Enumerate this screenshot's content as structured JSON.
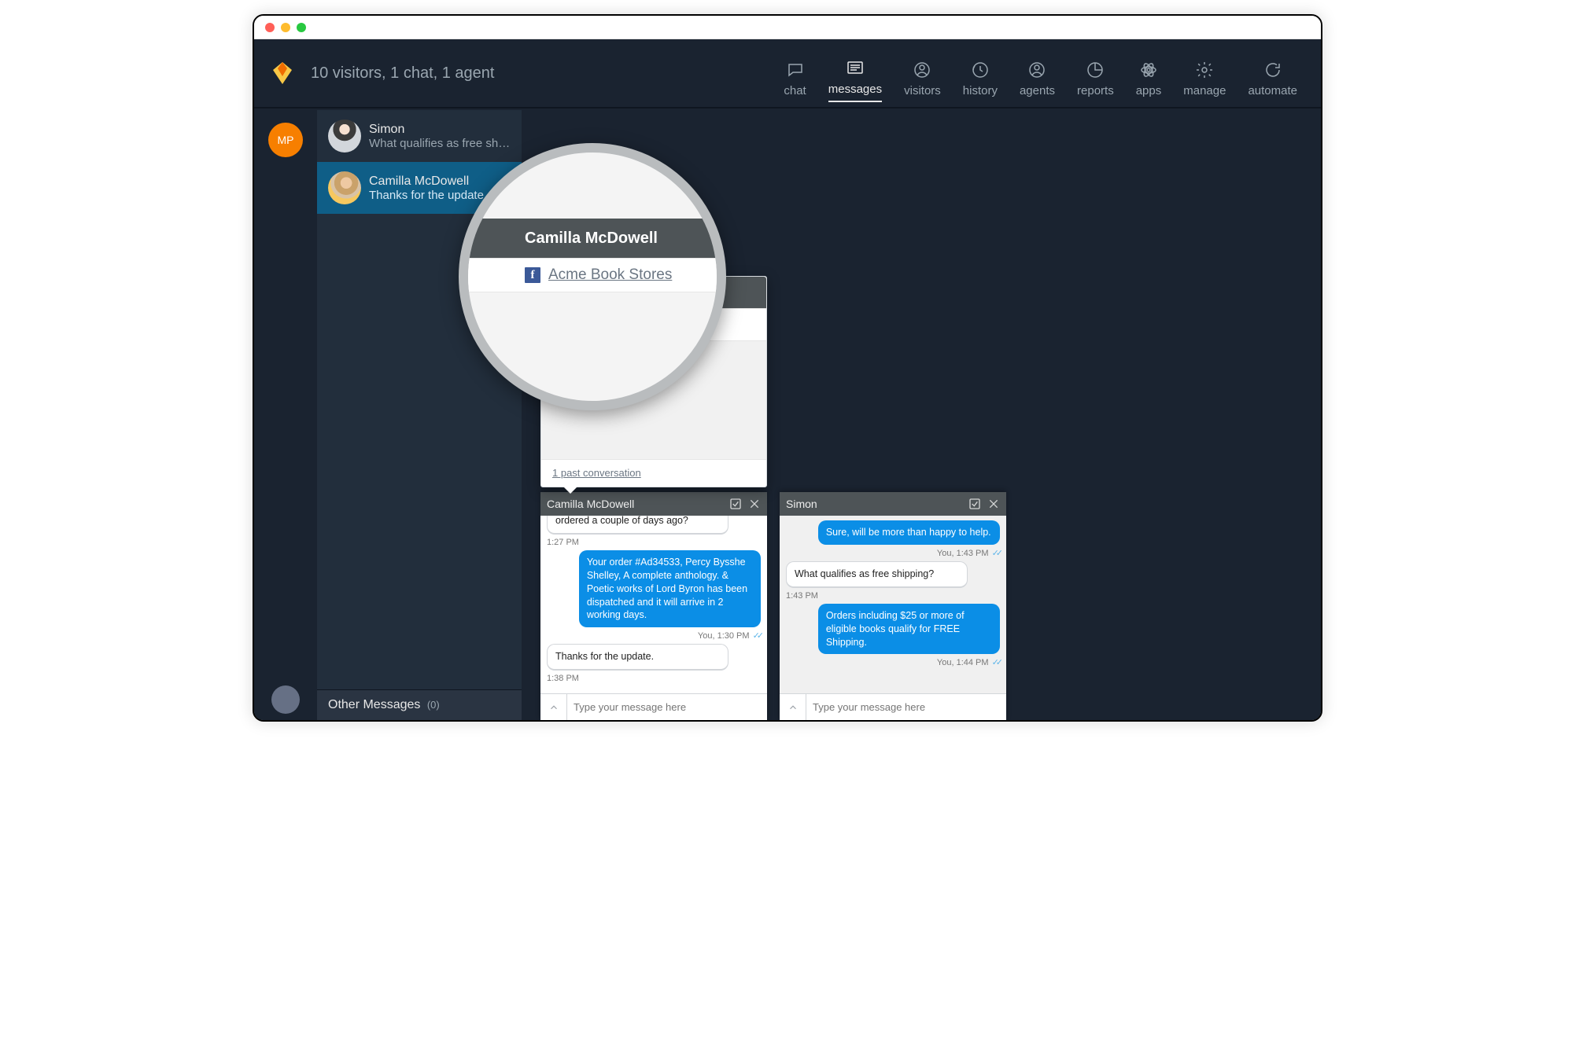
{
  "summary": "10 visitors, 1 chat, 1 agent",
  "agentInitials": "MP",
  "nav": {
    "chat": "chat",
    "messages": "messages",
    "visitors": "visitors",
    "history": "history",
    "agents": "agents",
    "reports": "reports",
    "apps": "apps",
    "manage": "manage",
    "automate": "automate"
  },
  "conversations": [
    {
      "name": "Simon",
      "preview": "What qualifies as free sh…"
    },
    {
      "name": "Camilla McDowell",
      "preview": "Thanks for the update."
    }
  ],
  "otherMessages": {
    "label": "Other Messages",
    "count": "(0)"
  },
  "profile": {
    "name": "Camilla McDowell",
    "pageLink": "Acme Book Stores",
    "pastConv": "1 past conversation"
  },
  "chatCamilla": {
    "title": "Camilla McDowell",
    "recvPartial": "ordered a couple of days ago?",
    "t1": "1:27 PM",
    "sent1": "Your order #Ad34533, Percy Bysshe Shelley, A complete anthology. & Poetic works of Lord Byron has been dispatched and it will arrive in 2 working days.",
    "t2": "You, 1:30 PM",
    "recv2": "Thanks for the update.",
    "t3": "1:38 PM",
    "placeholder": "Type your message here"
  },
  "chatSimon": {
    "title": "Simon",
    "sent1": "Sure, will be more than happy to help.",
    "t1": "You, 1:43 PM",
    "recv1": "What qualifies as free shipping?",
    "t2": "1:43 PM",
    "sent2": "Orders including $25 or more of eligible books qualify for FREE Shipping.",
    "t3": "You, 1:44 PM",
    "placeholder": "Type your message here"
  }
}
